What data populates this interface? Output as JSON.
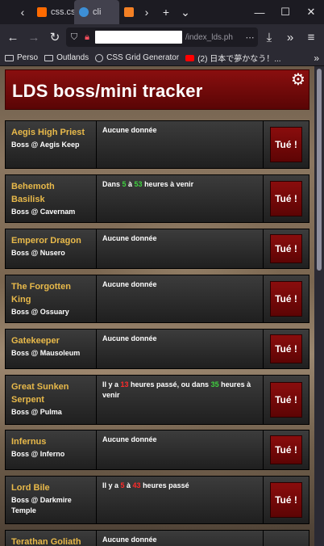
{
  "browser": {
    "tabs": [
      {
        "label": "css.css",
        "active": false,
        "fav_color": "#ff6a00"
      },
      {
        "label": "cli",
        "active": true,
        "fav_color": "#3d8fd6"
      },
      {
        "label": "",
        "active": false,
        "fav_color": "#f48024"
      }
    ],
    "url_suffix": "/index_lds.ph",
    "bookmarks": [
      {
        "label": "Perso",
        "icon": "folder-icon"
      },
      {
        "label": "Outlands",
        "icon": "folder-icon"
      },
      {
        "label": "CSS Grid Generator",
        "icon": "globe-icon"
      },
      {
        "label": "(2) 日本で夢かなう！...",
        "icon": "youtube-icon"
      }
    ]
  },
  "page": {
    "title": "LDS boss/mini tracker",
    "kill_label": "Tué !",
    "rows": [
      {
        "name": "Aegis High Priest",
        "loc": "Boss @ Aegis Keep",
        "info": "Aucune donnée"
      },
      {
        "name": "Behemoth Basilisk",
        "loc": "Boss @ Cavernam",
        "info_pre": "Dans ",
        "n1": "5",
        "info_mid": " à ",
        "n2": "53",
        "info_post": " heures à venir"
      },
      {
        "name": "Emperor Dragon",
        "loc": "Boss @ Nusero",
        "info": "Aucune donnée"
      },
      {
        "name": "The Forgotten King",
        "loc": "Boss @ Ossuary",
        "info": "Aucune donnée"
      },
      {
        "name": "Gatekeeper",
        "loc": "Boss @ Mausoleum",
        "info": "Aucune donnée"
      },
      {
        "name": "Great Sunken Serpent",
        "loc": "Boss @ Pulma",
        "info_pre": "Il y a ",
        "n1": "13",
        "info_mid": " heures passé, ou dans ",
        "n2": "35",
        "info_post": " heures à venir"
      },
      {
        "name": "Infernus",
        "loc": "Boss @ Inferno",
        "info": "Aucune donnée"
      },
      {
        "name": "Lord Bile",
        "loc": "Boss @ Darkmire Temple",
        "info_pre": "Il y a ",
        "n1": "5",
        "info_mid": " à ",
        "n2": "43",
        "info_post": " heures passé"
      },
      {
        "name": "Terathan Goliath",
        "loc": "",
        "info": "Aucune donnée"
      }
    ]
  }
}
